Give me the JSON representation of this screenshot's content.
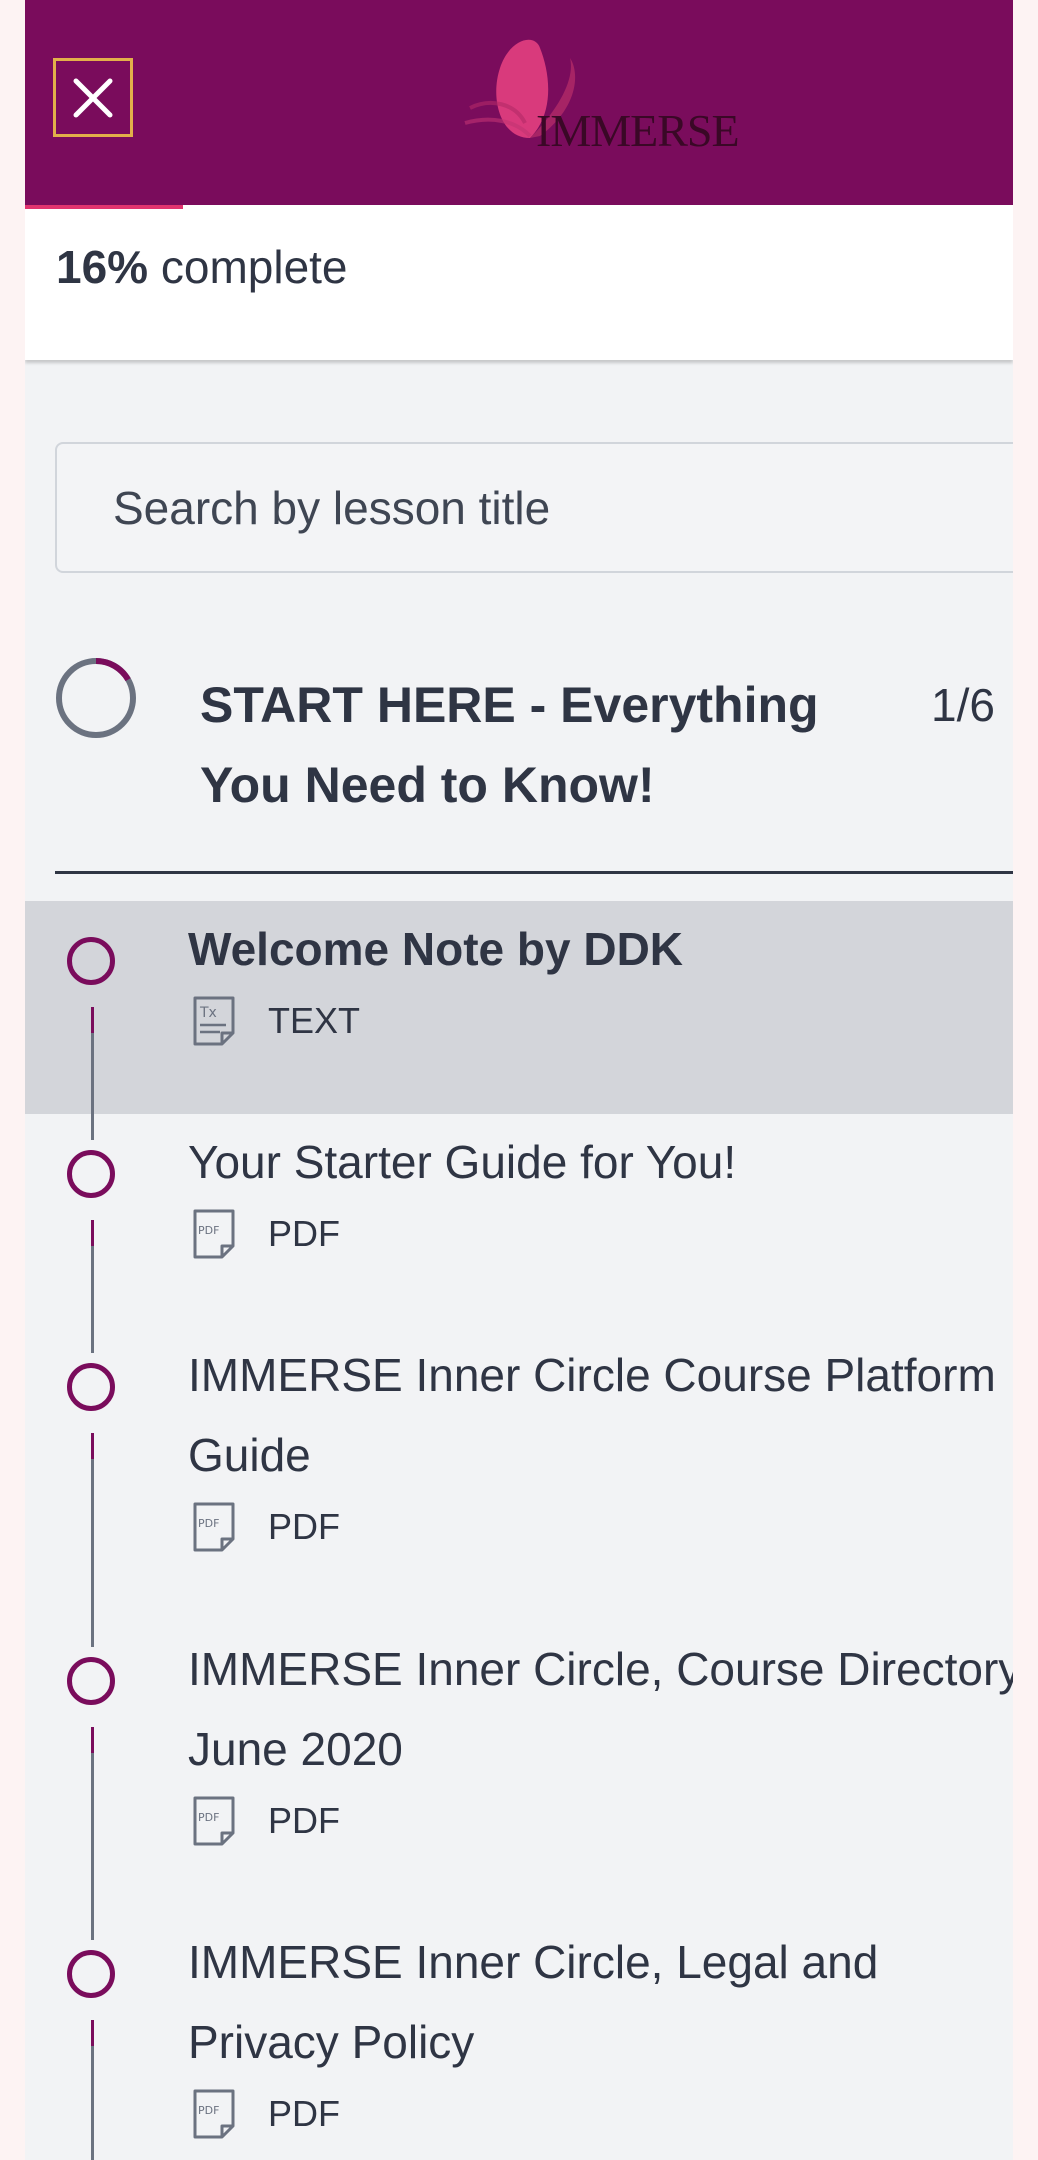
{
  "header": {
    "close_label": "Close",
    "brand": "IMMERSE"
  },
  "progress": {
    "percent": 16,
    "percent_text": "16%",
    "suffix": " complete"
  },
  "search": {
    "placeholder": "Search by lesson title"
  },
  "section": {
    "title": "START HERE - Everything You Need to Know!",
    "count": "1/6",
    "completed_fraction": 0.1667
  },
  "lessons": [
    {
      "title": "Welcome Note by DDK",
      "type": "TEXT",
      "active": true
    },
    {
      "title": "Your Starter Guide for You!",
      "type": "PDF",
      "active": false
    },
    {
      "title": "IMMERSE Inner Circle Course Platform Guide",
      "type": "PDF",
      "active": false
    },
    {
      "title": "IMMERSE Inner Circle, Course Directory June 2020",
      "type": "PDF",
      "active": false
    },
    {
      "title": "IMMERSE Inner Circle, Legal and Privacy Policy",
      "type": "PDF",
      "active": false
    }
  ],
  "colors": {
    "brand": "#7a0c5c",
    "accent": "#e1346f",
    "text": "#2f3544"
  }
}
